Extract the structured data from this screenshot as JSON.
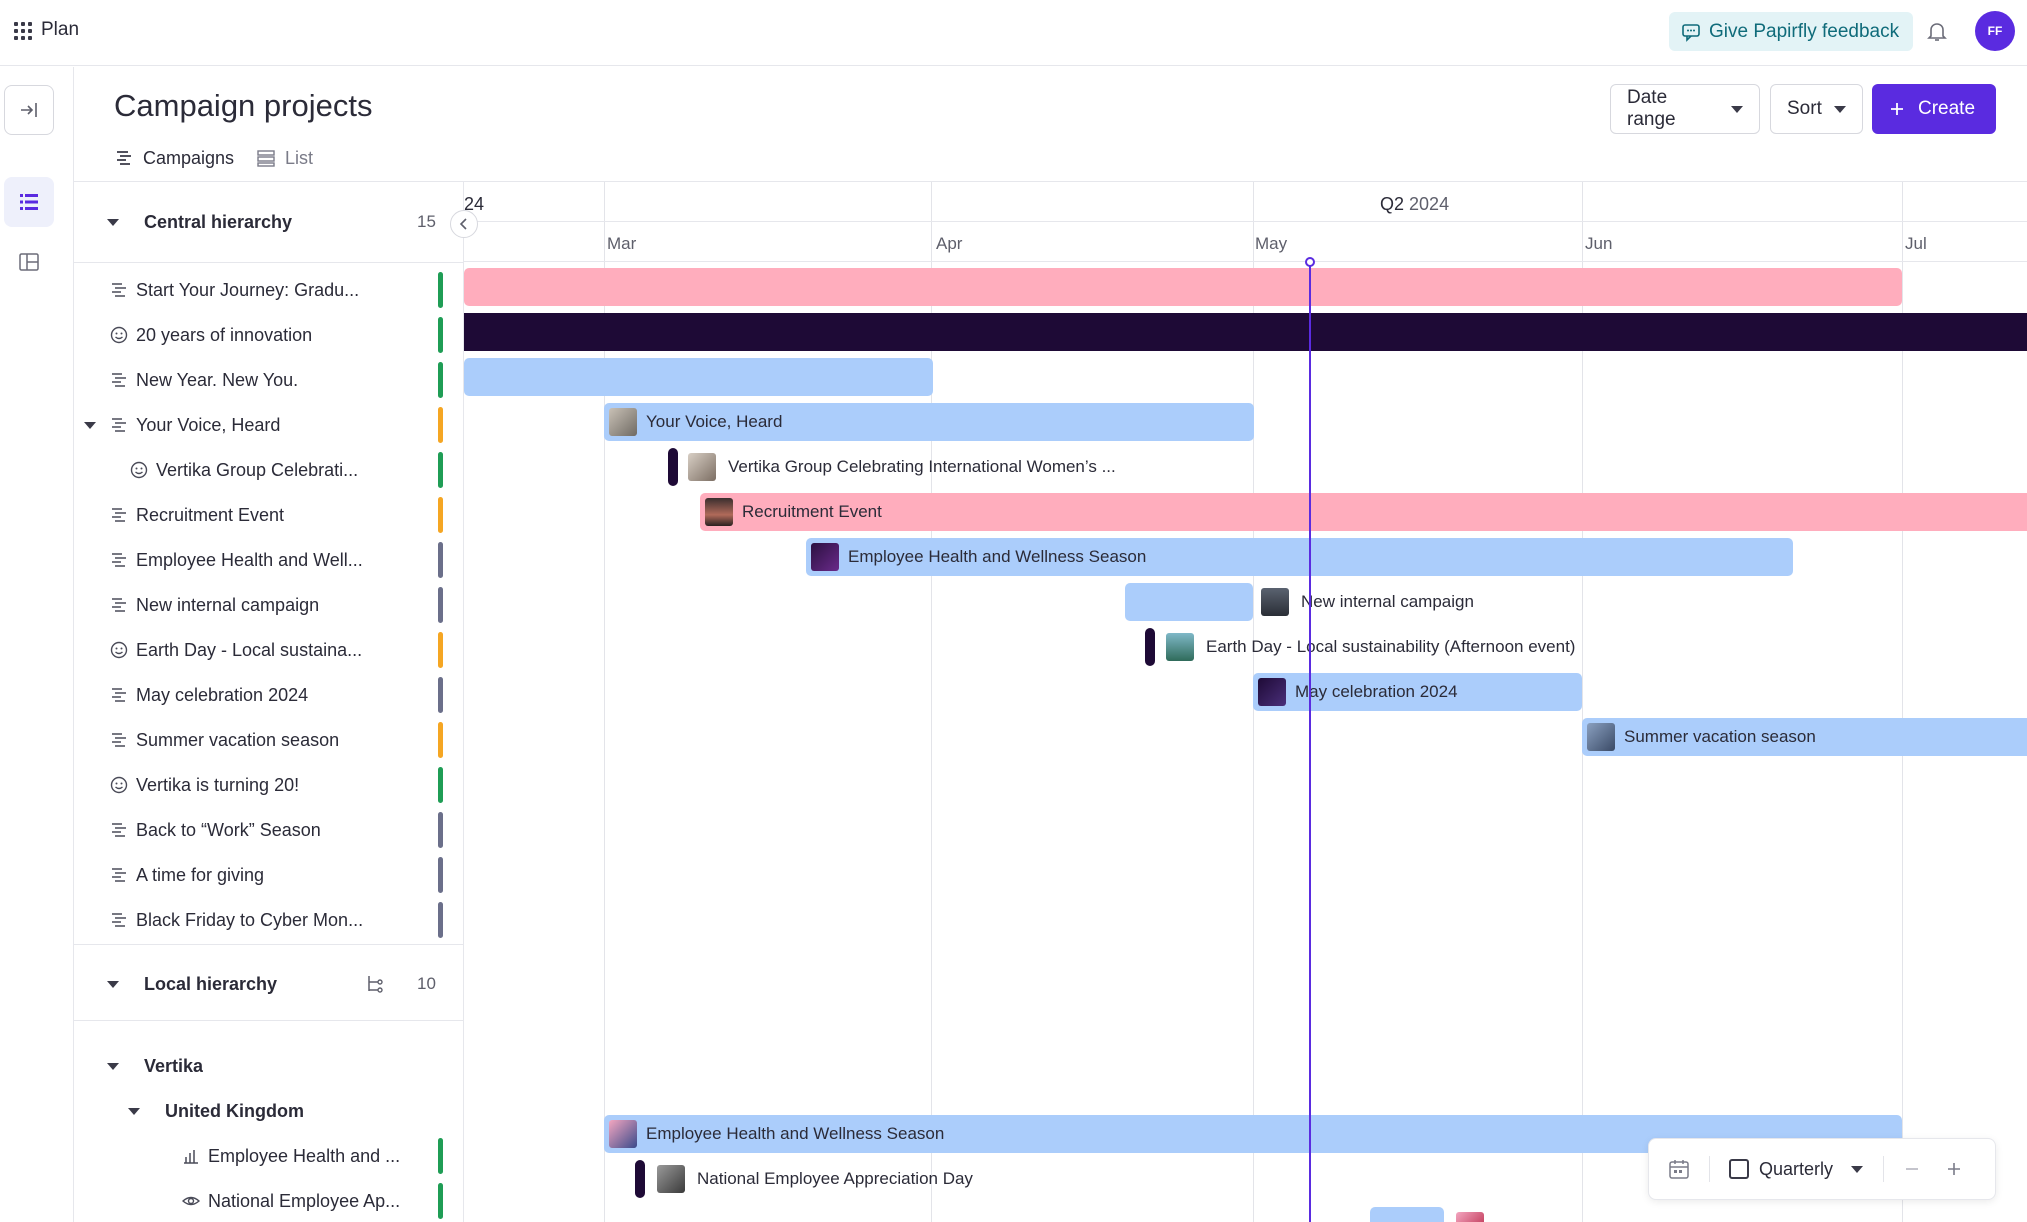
{
  "app": {
    "name": "Plan"
  },
  "topbar": {
    "feedback_label": "Give Papirfly feedback",
    "avatar_initials": "FF"
  },
  "page": {
    "title": "Campaign projects",
    "tabs": [
      {
        "label": "Campaigns",
        "active": true
      },
      {
        "label": "List",
        "active": false
      }
    ],
    "date_range_label": "Date range",
    "sort_label": "Sort",
    "create_label": "Create"
  },
  "groups": {
    "central": {
      "title": "Central hierarchy",
      "count": "15"
    },
    "local": {
      "title": "Local hierarchy",
      "count": "10"
    },
    "vertika": {
      "title": "Vertika"
    },
    "uk": {
      "title": "United Kingdom"
    }
  },
  "central_items": [
    {
      "label": "Start Your Journey: Gradu...",
      "icon": "campaign-icon",
      "stripe": "#1f9d55"
    },
    {
      "label": "20 years of innovation",
      "icon": "smiley-icon",
      "stripe": "#1f9d55"
    },
    {
      "label": "New Year. New You.",
      "icon": "campaign-icon",
      "stripe": "#1f9d55"
    },
    {
      "label": "Your Voice, Heard",
      "icon": "campaign-icon",
      "stripe": "#f5a623"
    },
    {
      "label": "Vertika Group Celebrati...",
      "icon": "smiley-icon",
      "stripe": "#1f9d55"
    },
    {
      "label": "Recruitment Event",
      "icon": "campaign-icon",
      "stripe": "#f5a623"
    },
    {
      "label": "Employee Health and Well...",
      "icon": "campaign-icon",
      "stripe": "#6b6f8a"
    },
    {
      "label": "New internal campaign",
      "icon": "campaign-icon",
      "stripe": "#6b6f8a"
    },
    {
      "label": "Earth Day - Local sustaina...",
      "icon": "smiley-icon",
      "stripe": "#f5a623"
    },
    {
      "label": "May celebration 2024",
      "icon": "campaign-icon",
      "stripe": "#6b6f8a"
    },
    {
      "label": "Summer vacation season",
      "icon": "campaign-icon",
      "stripe": "#f5a623"
    },
    {
      "label": "Vertika is turning 20!",
      "icon": "smiley-icon",
      "stripe": "#1f9d55"
    },
    {
      "label": "Back to “Work” Season",
      "icon": "campaign-icon",
      "stripe": "#6b6f8a"
    },
    {
      "label": "A time for giving",
      "icon": "campaign-icon",
      "stripe": "#6b6f8a"
    },
    {
      "label": "Black Friday to Cyber Mon...",
      "icon": "campaign-icon",
      "stripe": "#6b6f8a"
    }
  ],
  "local_items": [
    {
      "label": "Employee Health and ...",
      "icon": "chart-icon",
      "stripe": "#1f9d55"
    },
    {
      "label": "National Employee Ap...",
      "icon": "eye-icon",
      "stripe": "#1f9d55"
    }
  ],
  "timeline": {
    "quarter_label": "Q2",
    "quarter_year": "2024",
    "left_partial_label": "24",
    "months": [
      "Mar",
      "Apr",
      "May",
      "Jun",
      "Jul"
    ],
    "bar_labels": {
      "your_voice": "Your Voice, Heard",
      "vertika_group": "Vertika Group Celebrating International Women’s ...",
      "recruitment": "Recruitment Event",
      "employee_health": "Employee Health and Wellness Season",
      "new_internal": "New internal campaign",
      "earth_day": "Earth Day - Local sustainability (Afternoon event)",
      "may_celebration": "May celebration 2024",
      "summer_vacation": "Summer vacation season",
      "local_employee_health": "Employee Health and Wellness Season",
      "national_employee": "National Employee Appreciation Day"
    },
    "colors": {
      "pink": "#ffadbd",
      "blue": "#abcdfb",
      "dark": "#1e0a36",
      "today": "#5a2be0"
    }
  },
  "zoom": {
    "scale_label": "Quarterly"
  }
}
